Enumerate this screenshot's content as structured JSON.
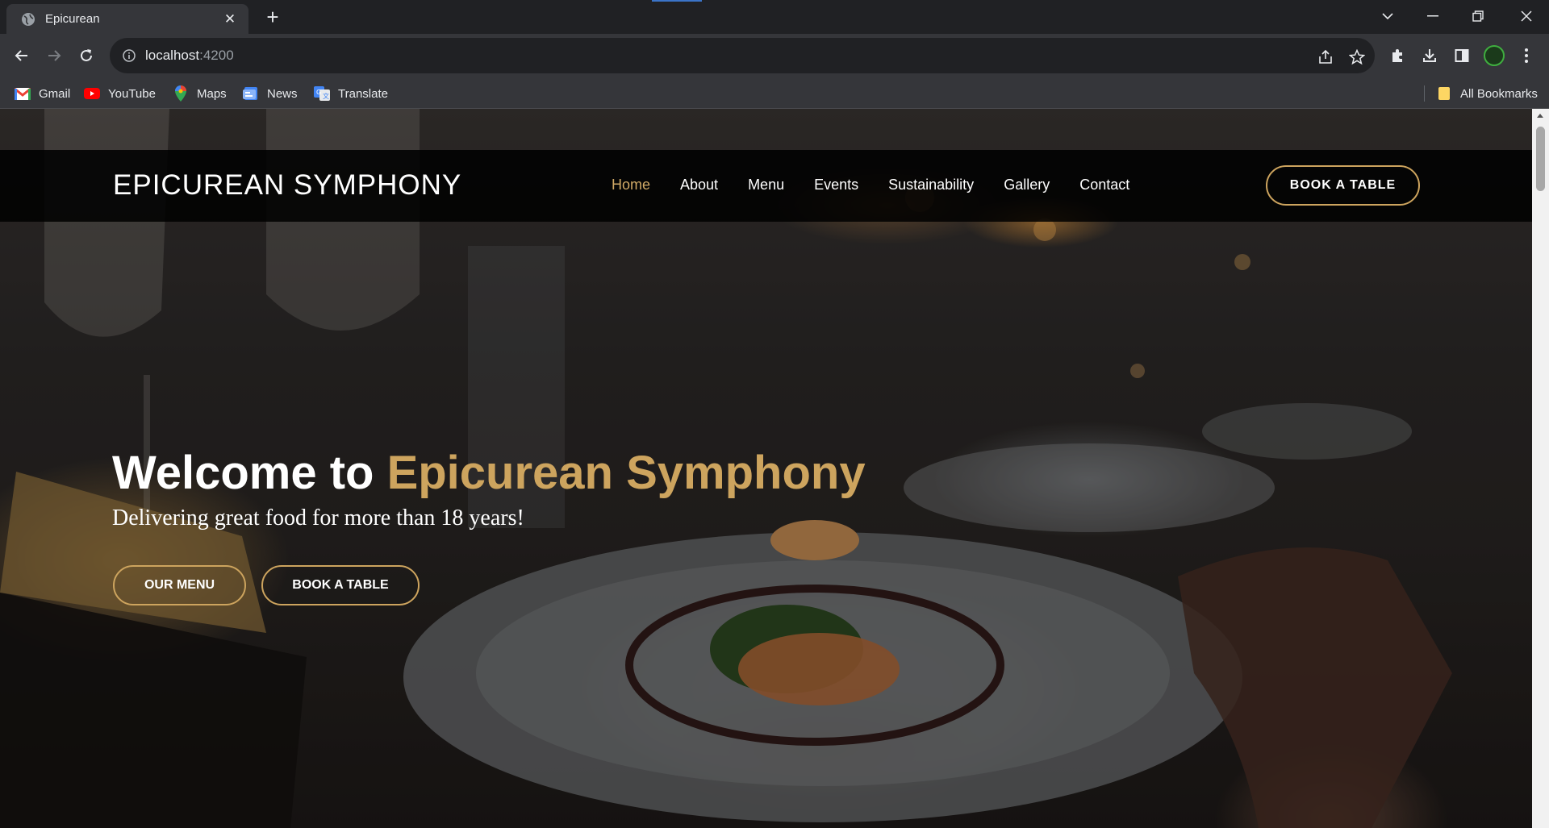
{
  "browser": {
    "tab_title": "Epicurean",
    "url_host": "localhost",
    "url_port": ":4200",
    "bookmarks": [
      {
        "label": "Gmail",
        "icon": "gmail-icon"
      },
      {
        "label": "YouTube",
        "icon": "youtube-icon"
      },
      {
        "label": "Maps",
        "icon": "maps-icon"
      },
      {
        "label": "News",
        "icon": "news-icon"
      },
      {
        "label": "Translate",
        "icon": "translate-icon"
      }
    ],
    "all_bookmarks_label": "All Bookmarks"
  },
  "site": {
    "brand": "EPICUREAN SYMPHONY",
    "nav": [
      "Home",
      "About",
      "Menu",
      "Events",
      "Sustainability",
      "Gallery",
      "Contact"
    ],
    "active_nav": "Home",
    "book_table_label": "BOOK A TABLE",
    "accent_color": "#cda45e"
  },
  "hero": {
    "title_prefix": "Welcome to ",
    "title_accent": "Epicurean Symphony",
    "subtitle": "Delivering great food for more than 18 years!",
    "menu_button": "OUR MENU",
    "book_button": "BOOK A TABLE"
  }
}
